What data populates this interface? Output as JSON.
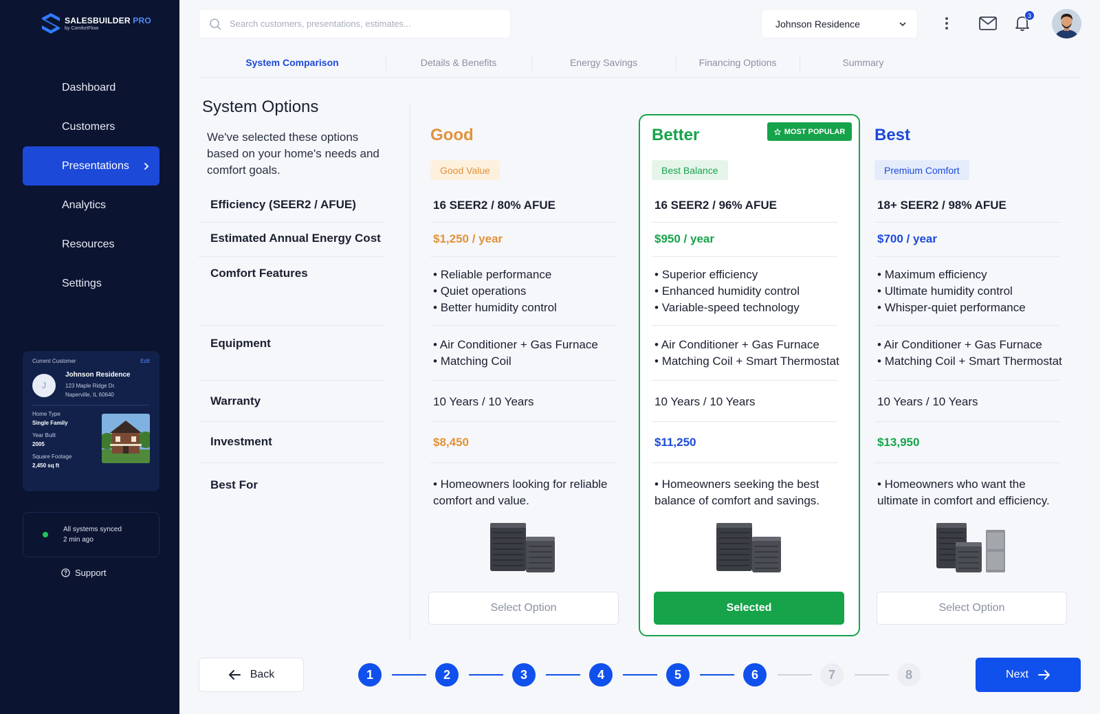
{
  "brand": {
    "name": "SALESBUILDER",
    "pro": "PRO",
    "sub": "by ComfortFlow"
  },
  "nav": [
    {
      "label": "Dashboard"
    },
    {
      "label": "Customers"
    },
    {
      "label": "Presentations",
      "active": true
    },
    {
      "label": "Analytics"
    },
    {
      "label": "Resources"
    },
    {
      "label": "Settings"
    }
  ],
  "customer_card": {
    "header": "Current Customer",
    "edit": "Edit",
    "initial": "J",
    "name": "Johnson Residence",
    "address_line1": "123 Maple Ridge Dr.",
    "address_line2": "Naperville, IL 60640",
    "home_type_label": "Home Type",
    "home_type": "Single Family",
    "year_built_label": "Year Built",
    "year_built": "2005",
    "sqft_label": "Square Footage",
    "sqft": "2,450 sq ft"
  },
  "sync": {
    "line1": "All systems synced",
    "line2": "2 min ago"
  },
  "support": "Support",
  "search": {
    "placeholder": "Search customers, presentations, estimates..."
  },
  "customer_select": {
    "value": "Johnson Residence"
  },
  "notifications": {
    "count": "3"
  },
  "tabs": [
    "System Comparison",
    "Details & Benefits",
    "Energy Savings",
    "Financing Options",
    "Summary"
  ],
  "options": {
    "title": "System Options",
    "description": "We've selected these options based on your home's needs and comfort goals."
  },
  "row_labels": {
    "efficiency": "Efficiency (SEER2 / AFUE)",
    "energy_cost": "Estimated Annual Energy Cost",
    "comfort": "Comfort Features",
    "equipment": "Equipment",
    "warranty": "Warranty",
    "investment": "Investment",
    "best_for": "Best For"
  },
  "plans": {
    "good": {
      "title": "Good",
      "tag": "Good Value",
      "efficiency": "16 SEER2 / 80% AFUE",
      "energy_cost": "$1,250 / year",
      "comfort": [
        "Reliable performance",
        "Quiet operations",
        "Better humidity control"
      ],
      "equipment": [
        "Air Conditioner + Gas Furnace",
        "Matching Coil"
      ],
      "warranty": "10 Years / 10 Years",
      "investment": "$8,450",
      "best_for": "• Homeowners looking for reliable comfort and value.",
      "button": "Select Option"
    },
    "better": {
      "title": "Better",
      "badge": "MOST POPULAR",
      "tag": "Best Balance",
      "efficiency": "16 SEER2 / 96% AFUE",
      "energy_cost": "$950 / year",
      "comfort": [
        "Superior efficiency",
        "Enhanced humidity control",
        "Variable-speed technology"
      ],
      "equipment": [
        "Air Conditioner + Gas Furnace",
        "Matching Coil + Smart Thermostat"
      ],
      "warranty": "10 Years / 10 Years",
      "investment": "$11,250",
      "best_for": "• Homeowners seeking the best balance of comfort and savings.",
      "button": "Selected"
    },
    "best": {
      "title": "Best",
      "tag": "Premium Comfort",
      "efficiency": "18+ SEER2 / 98% AFUE",
      "energy_cost": "$700 / year",
      "comfort": [
        "Maximum efficiency",
        "Ultimate humidity control",
        "Whisper-quiet performance"
      ],
      "equipment": [
        "Air Conditioner + Gas Furnace",
        "Matching Coil + Smart Thermostat"
      ],
      "warranty": "10 Years / 10 Years",
      "investment": "$13,950",
      "best_for": "• Homeowners who want the ultimate in comfort and efficiency.",
      "button": "Select Option"
    }
  },
  "colors": {
    "good": "#e2923a",
    "better": "#16a34a",
    "best": "#1d49d8",
    "accent": "#1050ec",
    "sidebar": "#0b1430"
  },
  "footer": {
    "back": "Back",
    "next": "Next",
    "steps": [
      "1",
      "2",
      "3",
      "4",
      "5",
      "6",
      "7",
      "8"
    ],
    "completed_steps": 6
  },
  "icons": [
    "search-icon",
    "chevron-down-icon",
    "more-vertical-icon",
    "mail-icon",
    "bell-icon",
    "chevron-right-icon",
    "star-icon",
    "help-circle-icon",
    "arrow-left-icon",
    "arrow-right-icon"
  ]
}
